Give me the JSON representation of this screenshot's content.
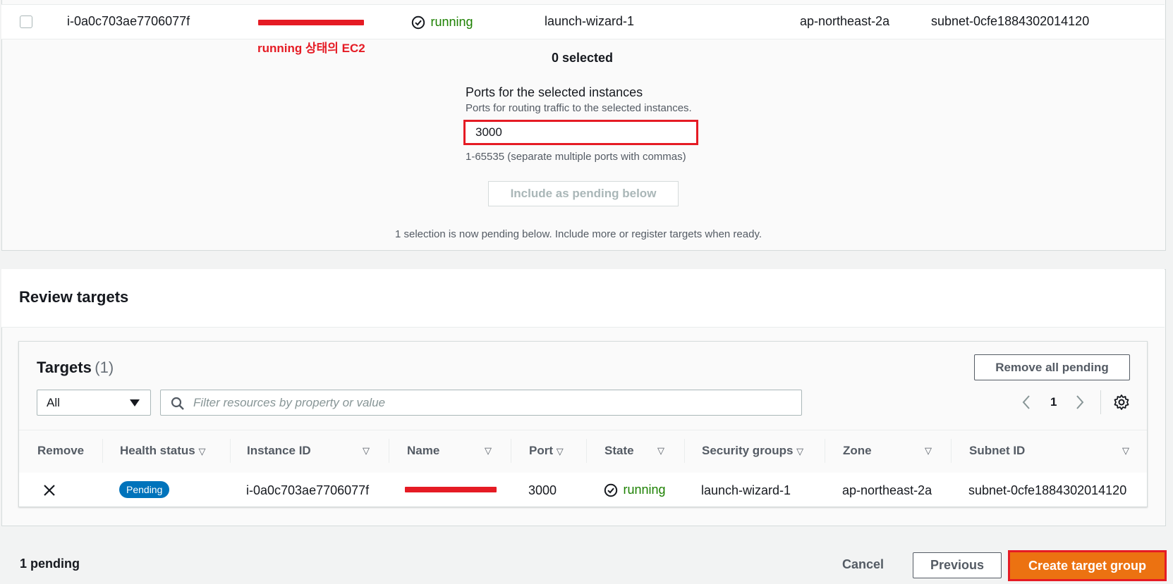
{
  "available_instance": {
    "instance_id": "i-0a0c703ae7706077f",
    "state": "running",
    "security_group": "launch-wizard-1",
    "zone": "ap-northeast-2a",
    "subnet_id": "subnet-0cfe1884302014120",
    "annotation": "running 상태의 EC2"
  },
  "register": {
    "selected_count": "0 selected",
    "ports_label": "Ports for the selected instances",
    "ports_description": "Ports for routing traffic to the selected instances.",
    "port_value": "3000",
    "ports_hint": "1-65535 (separate multiple ports with commas)",
    "include_button": "Include as pending below",
    "pending_note": "1 selection is now pending below. Include more or register targets when ready."
  },
  "review": {
    "title": "Review targets",
    "targets_title": "Targets",
    "targets_count": "(1)",
    "remove_all_button": "Remove all pending",
    "filter_select_value": "All",
    "filter_placeholder": "Filter resources by property or value",
    "page_number": "1",
    "columns": {
      "remove": "Remove",
      "health_status": "Health status",
      "instance_id": "Instance ID",
      "name": "Name",
      "port": "Port",
      "state": "State",
      "security_groups": "Security groups",
      "zone": "Zone",
      "subnet_id": "Subnet ID"
    },
    "row": {
      "health_status": "Pending",
      "instance_id": "i-0a0c703ae7706077f",
      "port": "3000",
      "state": "running",
      "security_group": "launch-wizard-1",
      "zone": "ap-northeast-2a",
      "subnet_id": "subnet-0cfe1884302014120"
    }
  },
  "footer": {
    "pending_count": "1 pending",
    "cancel_button": "Cancel",
    "previous_button": "Previous",
    "create_button": "Create target group"
  },
  "colors": {
    "accent_orange": "#ec7211",
    "annotation_red": "#e51b24",
    "status_green": "#1d8102",
    "pending_blue": "#0073bb"
  },
  "icons": {
    "status": "check-circle-icon",
    "remove": "close-icon",
    "search": "search-icon",
    "dropdown": "caret-down-icon",
    "sort": "sort-triangle-icon",
    "prev_page": "chevron-left-icon",
    "next_page": "chevron-right-icon",
    "settings": "gear-icon"
  }
}
